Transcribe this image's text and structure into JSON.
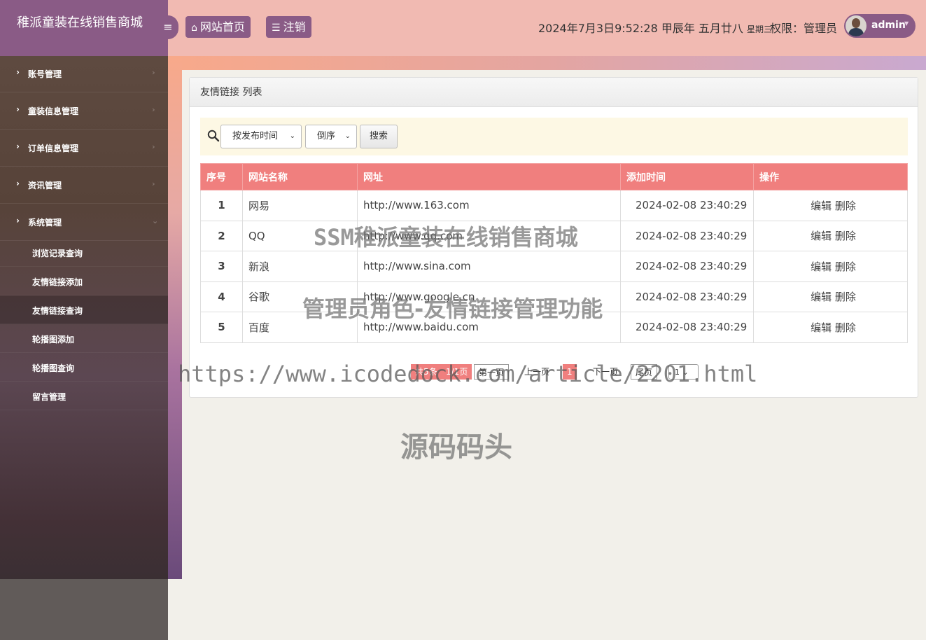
{
  "header": {
    "brand": "稚派童装在线销售商城",
    "nav": [
      {
        "label": "网站首页",
        "icon": "home-icon"
      },
      {
        "label": "注销",
        "icon": "list-icon"
      }
    ],
    "datetime": "2024年7月3日9:52:28 甲辰年 五月廿八",
    "weekday": "星期三",
    "role": "权限：管理员",
    "user": "admin"
  },
  "sidebar": {
    "menus": [
      {
        "label": "账号管理"
      },
      {
        "label": "童装信息管理"
      },
      {
        "label": "订单信息管理"
      },
      {
        "label": "资讯管理"
      },
      {
        "label": "系统管理"
      }
    ],
    "submenu": [
      {
        "label": "浏览记录查询"
      },
      {
        "label": "友情链接添加"
      },
      {
        "label": "友情链接查询"
      },
      {
        "label": "轮播图添加"
      },
      {
        "label": "轮播图查询"
      },
      {
        "label": "留言管理"
      }
    ]
  },
  "panel": {
    "title": "友情链接 列表",
    "sort_field": "按发布时间",
    "sort_order": "倒序",
    "search_label": "搜索"
  },
  "table": {
    "headers": [
      "序号",
      "网站名称",
      "网址",
      "添加时间",
      "操作"
    ],
    "rows": [
      {
        "no": "1",
        "name": "网易",
        "url": "http://www.163.com",
        "time": "2024-02-08 23:40:29"
      },
      {
        "no": "2",
        "name": "QQ",
        "url": "http://www.qq.com",
        "time": "2024-02-08 23:40:29"
      },
      {
        "no": "3",
        "name": "新浪",
        "url": "http://www.sina.com",
        "time": "2024-02-08 23:40:29"
      },
      {
        "no": "4",
        "name": "谷歌",
        "url": "http://www.google.cn",
        "time": "2024-02-08 23:40:29"
      },
      {
        "no": "5",
        "name": "百度",
        "url": "http://www.baidu.com",
        "time": "2024-02-08 23:40:29"
      }
    ],
    "edit_label": "编辑",
    "delete_label": "删除"
  },
  "pager": {
    "total": "共5条",
    "pages": "1/1页",
    "first": "第一页",
    "prev": "上一页",
    "current": "1",
    "next": "下一页",
    "last": "尾页",
    "jump_value": "1"
  },
  "watermark": {
    "line1": "SSM稚派童装在线销售商城",
    "line2": "管理员角色-友情链接管理功能",
    "line3": "https://www.icodedock.com/article/2201.html",
    "line4": "源码码头"
  }
}
